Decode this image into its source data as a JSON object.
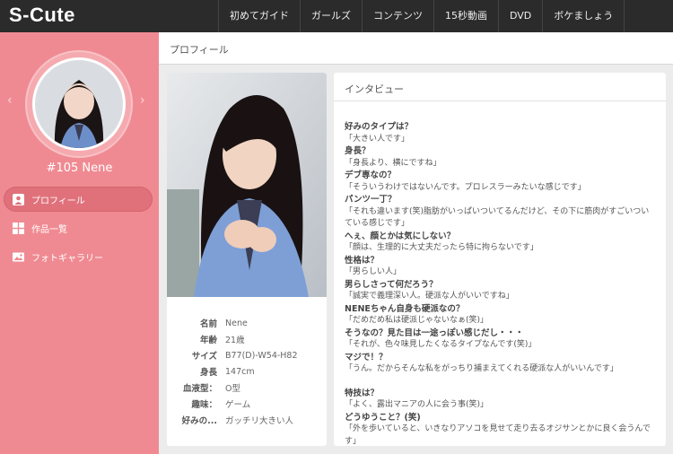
{
  "header": {
    "logo": "S-Cute",
    "nav": [
      "初めてガイド",
      "ガールズ",
      "コンテンツ",
      "15秒動画",
      "DVD",
      "ボケましょう"
    ]
  },
  "sidebar": {
    "model_name": "#105 Nene",
    "prev_arrow": "‹",
    "next_arrow": "›",
    "menu": [
      {
        "label": "プロフィール",
        "icon": "person-icon",
        "active": true
      },
      {
        "label": "作品一覧",
        "icon": "grid-icon",
        "active": false
      },
      {
        "label": "フォトギャラリー",
        "icon": "photo-icon",
        "active": false
      }
    ],
    "accent_color": "#f08a92"
  },
  "main": {
    "section_title": "プロフィール",
    "profile": {
      "specs": [
        {
          "label": "名前",
          "value": "Nene"
        },
        {
          "label": "年齢",
          "value": "21歳"
        },
        {
          "label": "サイズ",
          "value": "B77(D)-W54-H82"
        },
        {
          "label": "身長",
          "value": "147cm"
        },
        {
          "label": "血液型：",
          "value": "O型"
        },
        {
          "label": "趣味：",
          "value": "ゲーム"
        },
        {
          "label": "好みの...",
          "value": "ガッチリ大きい人"
        }
      ]
    },
    "interview": {
      "title": "インタビュー",
      "blocks": [
        [
          {
            "q": "好みのタイプは？",
            "a": "「大きい人です」"
          },
          {
            "q": "身長？",
            "a": "「身長より、横にですね」"
          },
          {
            "q": "デブ専なの？",
            "a": "「そういうわけではないんです。プロレスラーみたいな感じです」"
          },
          {
            "q": "パンツ一丁？",
            "a": "「それも違います(笑)脂肪がいっぱいついてるんだけど、その下に筋肉がすごいついている感じです」"
          },
          {
            "q": "へぇ、顔とかは気にしない？",
            "a": "「顔は、生理的に大丈夫だったら特に拘らないです」"
          },
          {
            "q": "性格は？",
            "a": "「男らしい人」"
          },
          {
            "q": "男らしさって何だろう？",
            "a": "「誠実で義理深い人。硬派な人がいいですね」"
          },
          {
            "q": "NENEちゃん自身も硬派なの？",
            "a": "「だめだめ私は硬派じゃないなぁ(笑)」"
          },
          {
            "q": "そうなの？見た目は一途っぽい感じだし・・・",
            "a": "「それが、色々味見したくなるタイプなんです(笑)」"
          },
          {
            "q": "マジで！？",
            "a": "「うん。だからそんな私をがっちり捕まえてくれる硬派な人がいいんです」"
          }
        ],
        [
          {
            "q": "特技は？",
            "a": "「よく、露出マニアの人に会う事(笑)」"
          },
          {
            "q": "どうゆうこと？(笑)",
            "a": "「外を歩いていると、いきなりアソコを見せて走り去るオジサンとかに良く会うんです」"
          }
        ]
      ]
    }
  }
}
